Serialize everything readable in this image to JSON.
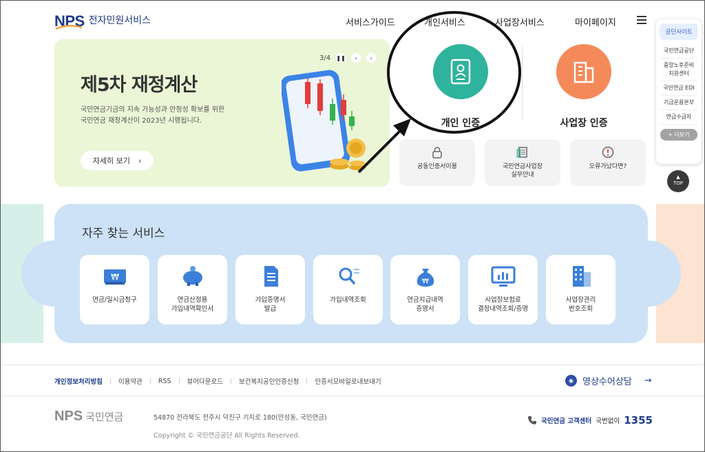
{
  "header": {
    "logo_mark": "NPS",
    "logo_text": "전자민원서비스",
    "nav": [
      "서비스가이드",
      "개인서비스",
      "사업장서비스",
      "마이페이지"
    ]
  },
  "hero": {
    "pager": "3/4",
    "title": "제5차 재정계산",
    "desc_line1": "국민연금기금의 지속 가능성과 안정성 확보를 위한",
    "desc_line2": "국민연금 재정계산이 2023년 시행됩니다.",
    "button": "자세히 보기",
    "button_arrow": "›"
  },
  "auth": {
    "personal": "개인 인증",
    "business": "사업장 인증",
    "personal_color": "#2fb39c",
    "business_color": "#f48a5a"
  },
  "quick_cards": [
    {
      "label": "공동인증서이용"
    },
    {
      "label1": "국민연금사업장",
      "label2": "실무안내"
    },
    {
      "label": "오류가났다면?"
    }
  ],
  "sidebar": {
    "head": "공단사이트",
    "items": [
      {
        "label": "국민연금공단"
      },
      {
        "label1": "중앙노후준비",
        "label2": "지원센터"
      },
      {
        "label": "국민연금 EDI"
      },
      {
        "label": "기금운용본부"
      },
      {
        "label": "연금수급자"
      }
    ],
    "more": "+ 더보기",
    "top": "TOP"
  },
  "frequent": {
    "title": "자주 찾는 서비스",
    "items": [
      {
        "line1": "연금/일시금청구",
        "line2": "",
        "icon": "won-card-icon"
      },
      {
        "line1": "연금산정용",
        "line2": "가입내역확인서",
        "icon": "piggy-bank-icon"
      },
      {
        "line1": "가입증명서",
        "line2": "발급",
        "icon": "document-icon"
      },
      {
        "line1": "가입내역조회",
        "line2": "",
        "icon": "search-list-icon"
      },
      {
        "line1": "연금지급내역",
        "line2": "증명서",
        "icon": "money-bag-icon"
      },
      {
        "line1": "사업장보험료",
        "line2": "결정내역조회/증명",
        "icon": "monitor-chart-icon"
      },
      {
        "line1": "사업장관리",
        "line2": "번호조회",
        "icon": "building-icon"
      }
    ]
  },
  "footer": {
    "links": [
      "개인정보처리방침",
      "이용약관",
      "RSS",
      "뷰어다운로드",
      "보건복지공인인증신청",
      "인증서모바일로내보내기"
    ],
    "consult": "영상수어상담",
    "consult_arrow": "→",
    "logo_mark": "NPS",
    "logo_text": "국민연금",
    "address": "54870 전라북도 전주시 덕진구 기지로 180(만성동, 국민연금)",
    "copyright": "Copyright © 국민연금공단 All Rights Reserved.",
    "call_center": "국민연금 고객센터",
    "call_prefix": "국번없이",
    "call_number": "1355"
  }
}
